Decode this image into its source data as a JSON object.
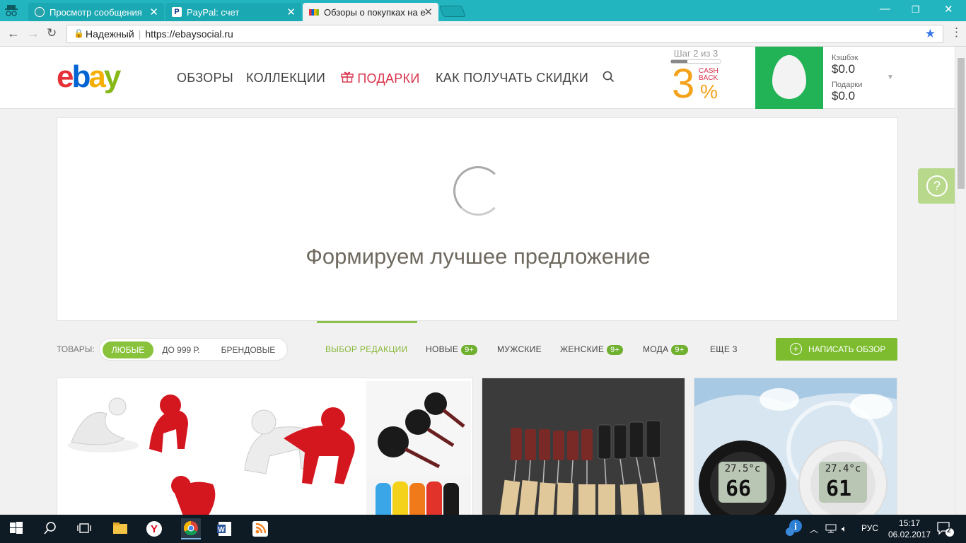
{
  "browser": {
    "tabs": [
      {
        "title": "Просмотр сообщения",
        "active": false
      },
      {
        "title": "PayPal: счет",
        "active": false
      },
      {
        "title": "Обзоры о покупках на е",
        "active": true
      }
    ],
    "secure_label": "Надежный",
    "url": "https://ebaysocial.ru"
  },
  "header": {
    "logo": [
      "e",
      "b",
      "a",
      "y"
    ],
    "nav": [
      "ОБЗОРЫ",
      "КОЛЛЕКЦИИ",
      "ПОДАРКИ",
      "КАК ПОЛУЧАТЬ СКИДКИ"
    ],
    "step_text": "Шаг 2 из 3",
    "step_progress": 0.33,
    "cashback_digit": "3",
    "cashback_word1": "CASH",
    "cashback_word2": "BACK",
    "cashback_pct": "%",
    "cashback_label": "Кэшбэк",
    "cashback_value": "$0.0",
    "gifts_label": "Подарки",
    "gifts_value": "$0.0"
  },
  "panel": {
    "loading_text": "Формируем лучшее предложение"
  },
  "filters": {
    "label": "ТОВАРЫ:",
    "pills": [
      "ЛЮБЫЕ",
      "ДО 999 Р.",
      "БРЕНДОВЫЕ"
    ],
    "tabs": [
      {
        "label": "ВЫБОР РЕДАКЦИИ",
        "badge": ""
      },
      {
        "label": "НОВЫЕ",
        "badge": "9+"
      },
      {
        "label": "МУЖСКИЕ",
        "badge": ""
      },
      {
        "label": "ЖЕНСКИЕ",
        "badge": "9+"
      },
      {
        "label": "МОДА",
        "badge": "9+"
      },
      {
        "label": "ЕЩЕ 3",
        "badge": ""
      }
    ],
    "write_review": "НАПИСАТЬ ОБЗОР"
  },
  "cards": {
    "thermo_left_temp": "27.5°c",
    "thermo_left_hum": "66",
    "thermo_right_temp": "27.4°c",
    "thermo_right_hum": "61"
  },
  "taskbar": {
    "lang": "РУС",
    "time": "15:17",
    "date": "06.02.2017",
    "notif_count": "2"
  }
}
